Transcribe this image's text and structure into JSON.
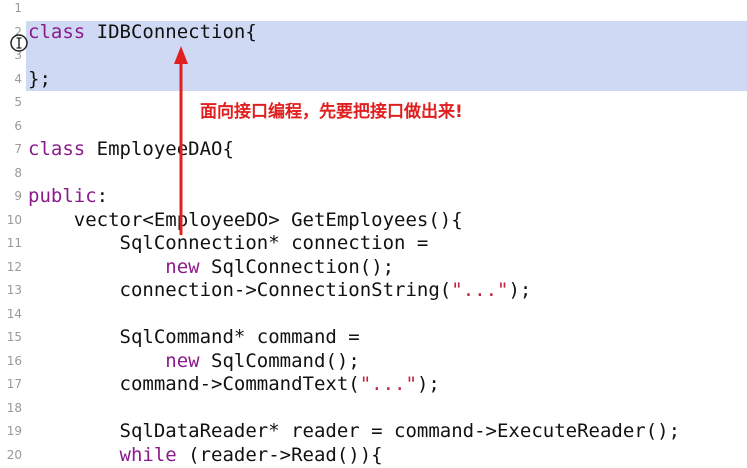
{
  "editor": {
    "lines": [
      {
        "num": "1",
        "parts": []
      },
      {
        "num": "2",
        "selected": true,
        "parts": [
          {
            "t": "class",
            "c": "kw"
          },
          {
            "t": " IDBConnection{"
          }
        ]
      },
      {
        "num": "3",
        "selected": true,
        "parts": []
      },
      {
        "num": "4",
        "selected": true,
        "parts": [
          {
            "t": "};"
          }
        ]
      },
      {
        "num": "5",
        "parts": []
      },
      {
        "num": "6",
        "parts": []
      },
      {
        "num": "7",
        "parts": [
          {
            "t": "class",
            "c": "kw"
          },
          {
            "t": " EmployeeDAO{"
          }
        ]
      },
      {
        "num": "8",
        "parts": []
      },
      {
        "num": "9",
        "parts": [
          {
            "t": "public",
            "c": "kw"
          },
          {
            "t": ":"
          }
        ]
      },
      {
        "num": "10",
        "parts": [
          {
            "t": "    vector<EmployeeDO> GetEmployees(){"
          }
        ]
      },
      {
        "num": "11",
        "parts": [
          {
            "t": "        SqlConnection* connection ="
          }
        ]
      },
      {
        "num": "12",
        "parts": [
          {
            "t": "            "
          },
          {
            "t": "new",
            "c": "kw"
          },
          {
            "t": " SqlConnection();"
          }
        ]
      },
      {
        "num": "13",
        "parts": [
          {
            "t": "        connection->ConnectionString("
          },
          {
            "t": "\"...\"",
            "c": "str"
          },
          {
            "t": ");"
          }
        ]
      },
      {
        "num": "14",
        "parts": []
      },
      {
        "num": "15",
        "parts": [
          {
            "t": "        SqlCommand* command ="
          }
        ]
      },
      {
        "num": "16",
        "parts": [
          {
            "t": "            "
          },
          {
            "t": "new",
            "c": "kw"
          },
          {
            "t": " SqlCommand();"
          }
        ]
      },
      {
        "num": "17",
        "parts": [
          {
            "t": "        command->CommandText("
          },
          {
            "t": "\"...\"",
            "c": "str"
          },
          {
            "t": ");"
          }
        ]
      },
      {
        "num": "18",
        "parts": []
      },
      {
        "num": "19",
        "parts": [
          {
            "t": "        SqlDataReader* reader = command->ExecuteReader();"
          }
        ]
      },
      {
        "num": "20",
        "parts": [
          {
            "t": "        "
          },
          {
            "t": "while",
            "c": "kw"
          },
          {
            "t": " (reader->Read()){"
          }
        ]
      }
    ]
  },
  "annotation": {
    "text": "面向接口编程，先要把接口做出来!",
    "color": "#e02020"
  },
  "cursor": {
    "icon": "text-cursor-icon"
  }
}
